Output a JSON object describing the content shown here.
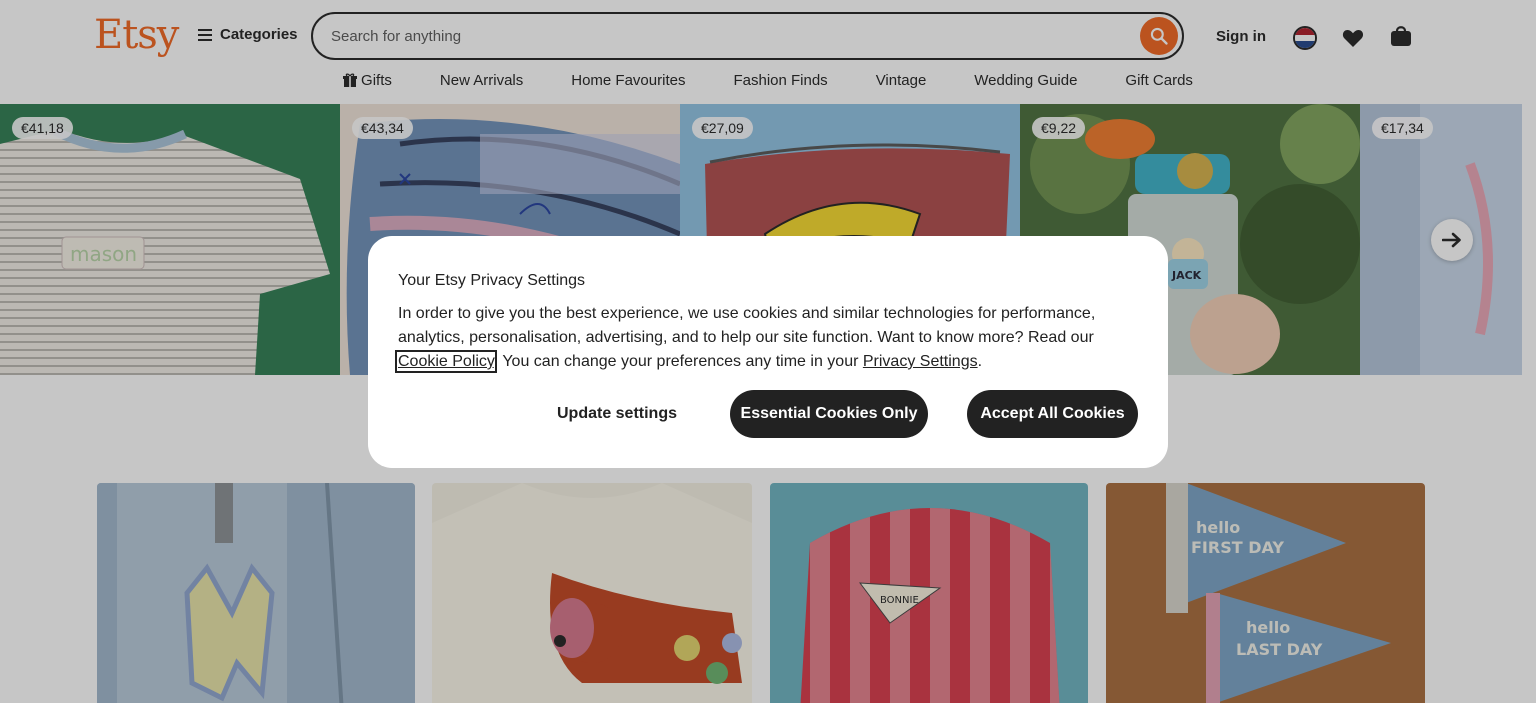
{
  "header": {
    "logo": "Etsy",
    "categories_label": "Categories",
    "search_placeholder": "Search for anything",
    "signin_label": "Sign in",
    "nav": [
      {
        "label": "Gifts",
        "icon": "gift-icon"
      },
      {
        "label": "New Arrivals"
      },
      {
        "label": "Home Favourites"
      },
      {
        "label": "Fashion Finds"
      },
      {
        "label": "Vintage"
      },
      {
        "label": "Wedding Guide"
      },
      {
        "label": "Gift Cards"
      }
    ]
  },
  "carousel": {
    "items": [
      {
        "price": "€41,18",
        "image": "striped-tshirt-with-name"
      },
      {
        "price": "€43,34",
        "image": "denim-pencil-cases"
      },
      {
        "price": "€27,09",
        "image": "banana-pouch"
      },
      {
        "price": "€9,22",
        "image": "kids-water-bottle"
      },
      {
        "price": "€17,34",
        "image": "partial-item"
      }
    ]
  },
  "grid": {
    "items": [
      {
        "image": "letter-m-bag-charm"
      },
      {
        "image": "dachshund-tshirt"
      },
      {
        "image": "bonnie-backpack"
      },
      {
        "image": "first-last-day-pennants"
      }
    ]
  },
  "privacy_dialog": {
    "title": "Your Etsy Privacy Settings",
    "body_part1": "In order to give you the best experience, we use cookies and similar technologies for performance, analytics, personalisation, advertising, and to help our site function. Want to know more? Read our ",
    "cookie_policy_link": "Cookie Policy",
    "body_part2": ". You can change your preferences any time in your ",
    "privacy_settings_link": "Privacy Settings",
    "body_part3": ".",
    "update_settings_label": "Update settings",
    "essential_label": "Essential Cookies Only",
    "accept_label": "Accept All Cookies"
  },
  "colors": {
    "brand_orange": "#F1641E",
    "dark_button": "#222222"
  }
}
